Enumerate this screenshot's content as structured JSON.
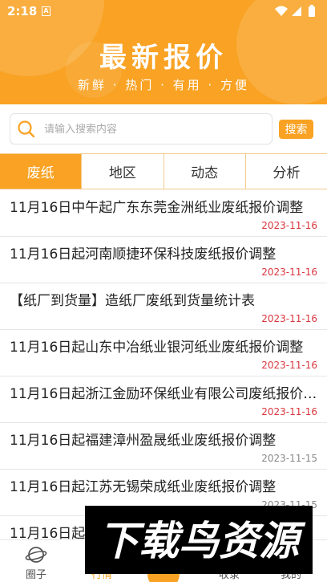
{
  "status": {
    "time": "2:18",
    "notification_badge": "A"
  },
  "header": {
    "title": "最新报价",
    "subtitle": "新鲜 · 热门 · 有用 · 方便"
  },
  "search": {
    "placeholder": "请输入搜索内容",
    "button_label": "搜索"
  },
  "tabs": [
    {
      "label": "废纸",
      "active": true
    },
    {
      "label": "地区",
      "active": false
    },
    {
      "label": "动态",
      "active": false
    },
    {
      "label": "分析",
      "active": false
    }
  ],
  "items": [
    {
      "title": "11月16日中午起广东东莞金洲纸业废纸报价调整",
      "date": "2023-11-16"
    },
    {
      "title": "11月16日起河南顺捷环保科技废纸报价调整",
      "date": "2023-11-16"
    },
    {
      "title": "【纸厂到货量】造纸厂废纸到货量统计表",
      "date": "2023-11-16"
    },
    {
      "title": "11月16日起山东中冶纸业银河纸业废纸报价调整",
      "date": "2023-11-16"
    },
    {
      "title": "11月16日起浙江金励环保纸业有限公司废纸报价调整",
      "date": "2023-11-16"
    },
    {
      "title": "11月16日起福建漳州盈晟纸业废纸报价调整",
      "date": "2023-11-15"
    },
    {
      "title": "11月16日起江苏无锡荣成纸业废纸报价调整",
      "date": "2023-11-15"
    },
    {
      "title": "11月16日起",
      "date": ""
    }
  ],
  "bottom_nav": [
    {
      "label": "圈子",
      "icon": "planet-icon"
    },
    {
      "label": "行情",
      "icon": "chart-icon"
    },
    {
      "label": "",
      "icon": "center-icon"
    },
    {
      "label": "收录",
      "icon": "bookmark-icon"
    },
    {
      "label": "我的",
      "icon": "profile-icon"
    }
  ],
  "watermark": {
    "text": "下载鸟资源"
  },
  "colors": {
    "accent": "#f9a223",
    "date_red": "#d9363e",
    "date_gray": "#888888"
  }
}
